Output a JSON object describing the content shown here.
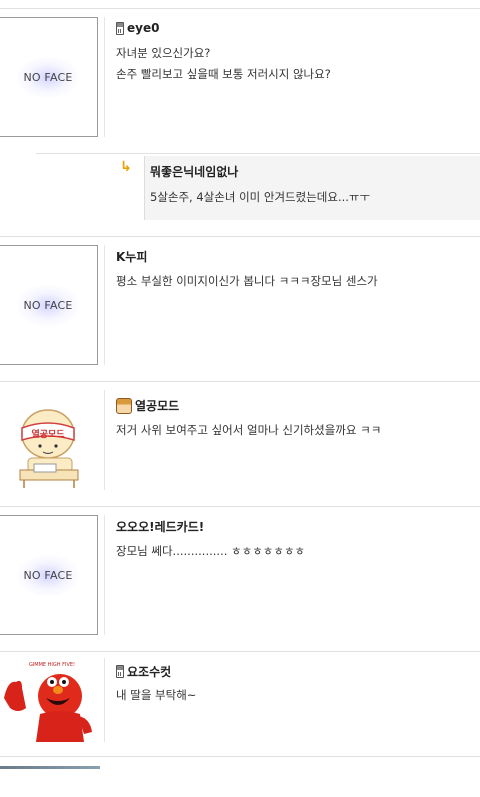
{
  "comments": [
    {
      "avatar": "NO FACE",
      "author": "eye0",
      "author_icon": "phone-icon",
      "lines": [
        "자녀분 있으신가요?",
        "손주 빨리보고 싶을때 보통 저러시지 않나요?"
      ]
    },
    {
      "avatar": "NO FACE",
      "author": "K누피",
      "lines": [
        "평소 부실한 이미지이신가 봅니다 ㅋㅋㅋ장모님 센스가"
      ]
    },
    {
      "avatar": "cartoon-avatar",
      "author": "열공모드",
      "author_icon": "user-badge-icon",
      "lines": [
        "저거 사위 보여주고 싶어서 얼마나 신기하셨을까요 ㅋㅋ"
      ]
    },
    {
      "avatar": "NO FACE",
      "author": "오오오!레드카드!",
      "lines": [
        "장모님 쎄다............... ㅎㅎㅎㅎㅎㅎㅎ"
      ]
    },
    {
      "avatar": "elmo-image",
      "author": "요조수컷",
      "author_icon": "phone-icon",
      "lines": [
        "내 딸을 부탁해~"
      ]
    }
  ],
  "reply": {
    "author": "뭐좋은닉네임없나",
    "text": "5살손주, 4살손녀 이미 안겨드렸는데요...ㅠㅜ",
    "icon": "reply-arrow-icon",
    "accent": "#e8a200"
  },
  "avatar_captions": {
    "cartoon_badge": "열공모드",
    "elmo_sign": "GIMME HIGH FIVE!"
  }
}
